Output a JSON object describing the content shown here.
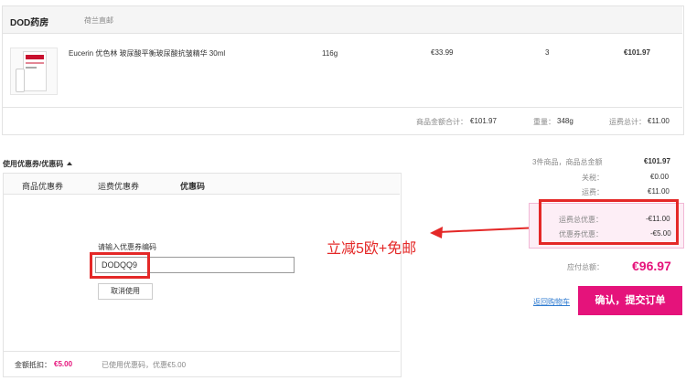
{
  "store": {
    "name": "DOD药房",
    "origin": "荷兰直邮"
  },
  "product": {
    "image_brand": "Eucerin",
    "name": "Eucerin 优色林 玻尿酸平衡玻尿酸抗皱精华 30ml",
    "weight": "116g",
    "price": "€33.99",
    "quantity": "3",
    "subtotal": "€101.97"
  },
  "shipment_summary": {
    "goods_total_label": "商品金额合计：",
    "goods_total_value": "€101.97",
    "weight_label": "重量：",
    "weight_value": "348g",
    "shipping_total_label": "运费总计：",
    "shipping_total_value": "€11.00"
  },
  "coupon": {
    "section_title": "使用优惠券/优惠码",
    "toggle_icon": "caret-up-icon",
    "tabs": [
      "商品优惠券",
      "运费优惠券",
      "优惠码"
    ],
    "active_tab_index": 2,
    "input_label": "请输入优惠券编码",
    "input_value": "DODQQ9",
    "cancel_label": "取消使用",
    "deduct_label": "金额抵扣：",
    "deduct_value": "€5.00",
    "used_note": "已使用优惠码，优惠€5.00"
  },
  "summary": {
    "items_label": "3件商品，商品总金额",
    "items_value": "€101.97",
    "tax_label": "关税：",
    "tax_value": "€0.00",
    "shipping_label": "运费：",
    "shipping_value": "€11.00",
    "ship_discount_label": "运费总优惠：",
    "ship_discount_value": "-€11.00",
    "coupon_discount_label": "优惠券优惠：",
    "coupon_discount_value": "-€5.00",
    "payable_label": "应付总额：",
    "payable_value": "€96.97",
    "back_to_cart": "返回购物车",
    "submit_label": "确认，提交订单"
  },
  "annotation": {
    "text": "立减5欧+免邮",
    "color": "#e42827"
  },
  "colors": {
    "accent": "#e5137b",
    "highlight_bg": "#fdeef6",
    "annotation": "#e42827"
  }
}
